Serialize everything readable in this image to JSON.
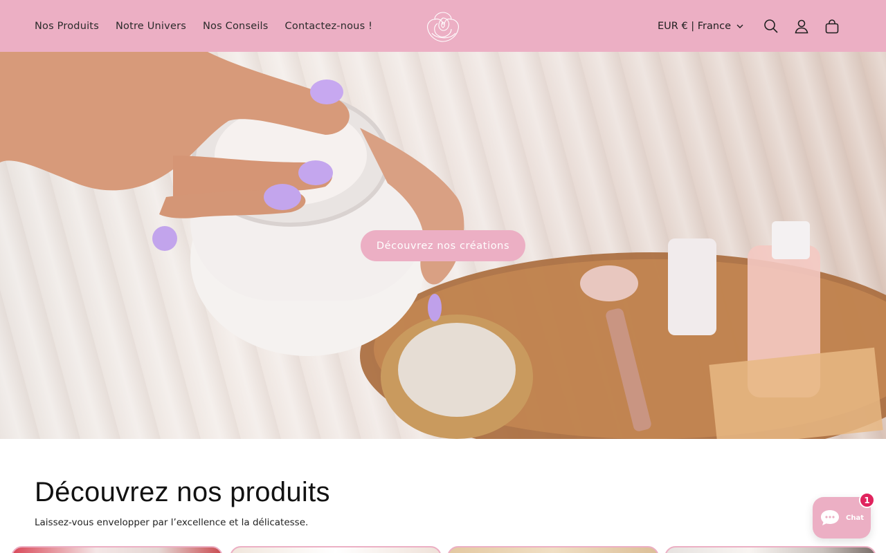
{
  "header": {
    "nav": [
      {
        "label": "Nos Produits"
      },
      {
        "label": "Notre Univers"
      },
      {
        "label": "Nos Conseils"
      },
      {
        "label": "Contactez-nous !"
      }
    ],
    "currency": "EUR € | France"
  },
  "hero": {
    "cta_label": "Découvrez nos créations"
  },
  "section": {
    "title": "Découvrez nos produits",
    "subtitle": "Laissez-vous envelopper par l’excellence et la délicatesse."
  },
  "chat": {
    "label": "Chat",
    "badge": "1"
  },
  "colors": {
    "brand_pink": "#ecafc4",
    "badge_red": "#e0245e"
  },
  "icons": [
    "rose-logo-icon",
    "chevron-down-icon",
    "search-icon",
    "account-icon",
    "cart-icon",
    "chat-bubble-icon"
  ]
}
